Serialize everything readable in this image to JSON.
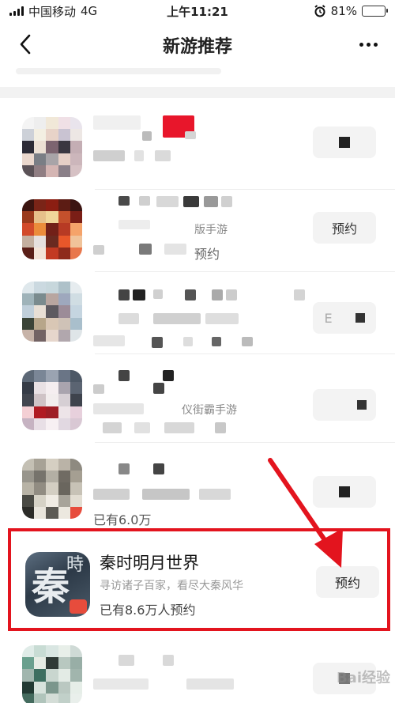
{
  "status_bar": {
    "carrier": "中国移动",
    "network": "4G",
    "time": "上午11:21",
    "battery": "81%",
    "battery_level": 0.81
  },
  "nav": {
    "title": "新游推荐"
  },
  "list": {
    "partial_labels": {
      "row2_subtitle": "版手游",
      "row2_reserve": "预约",
      "row2_button": "预约",
      "row3_button": "E",
      "row4_subtitle": "仪街霸手游",
      "row5_count": "已有6.0万"
    },
    "highlighted": {
      "icon_main_char": "秦",
      "icon_small_char": "時",
      "name": "秦时明月世界",
      "description": "寻访诸子百家，看尽大秦风华",
      "reservations": "已有8.6万人预约",
      "button": "预约"
    }
  },
  "watermark": "Bai经验",
  "colors": {
    "highlight_red": "#e3141e",
    "battery_green": "#4cd964"
  }
}
